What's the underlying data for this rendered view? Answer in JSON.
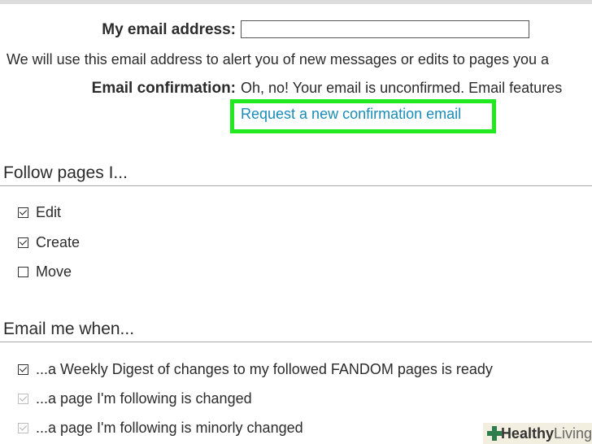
{
  "email_section": {
    "email_label": "My email address:",
    "email_value": "",
    "help_text": "We will use this email address to alert you of new messages or edits to pages you a",
    "confirmation_label": "Email confirmation:",
    "confirmation_status": "Oh, no! Your email is unconfirmed. Email features",
    "request_link": "Request a new confirmation email",
    "highlight_color": "#22e81f",
    "link_color": "#1b8bb8"
  },
  "follow_section": {
    "heading": "Follow pages I...",
    "options": [
      {
        "label": "Edit",
        "checked": true
      },
      {
        "label": "Create",
        "checked": true
      },
      {
        "label": "Move",
        "checked": false
      }
    ]
  },
  "email_me_section": {
    "heading": "Email me when...",
    "options": [
      {
        "label": "...a Weekly Digest of changes to my followed FANDOM pages is ready",
        "checked": true,
        "disabled": false
      },
      {
        "label": "...a page I'm following is changed",
        "checked": true,
        "disabled": true
      },
      {
        "label": "...a page I'm following is minorly changed",
        "checked": true,
        "disabled": true
      }
    ]
  },
  "watermark": {
    "brand_bold": "Healthy",
    "brand_light": "Living",
    "icon": "medical-cross-icon",
    "icon_color": "#2e7d4f"
  }
}
